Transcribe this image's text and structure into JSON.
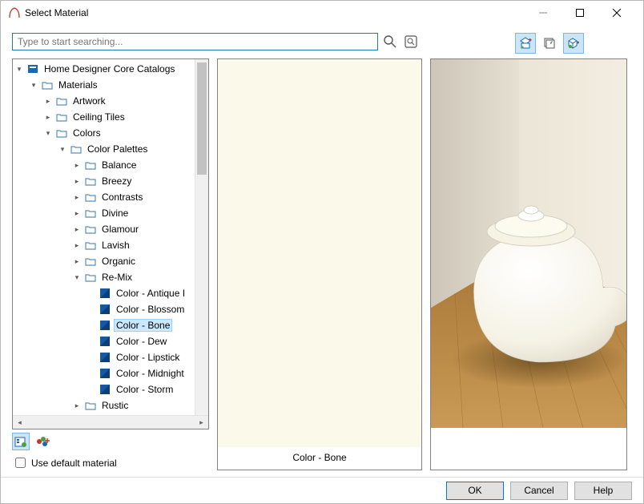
{
  "window": {
    "title": "Select Material"
  },
  "search": {
    "placeholder": "Type to start searching..."
  },
  "tree": {
    "root": "Home Designer Core Catalogs",
    "materials": "Materials",
    "artwork": "Artwork",
    "ceiling": "Ceiling Tiles",
    "colors": "Colors",
    "palettes": "Color Palettes",
    "balance": "Balance",
    "breezy": "Breezy",
    "contrasts": "Contrasts",
    "divine": "Divine",
    "glamour": "Glamour",
    "lavish": "Lavish",
    "organic": "Organic",
    "remix": "Re-Mix",
    "antique": "Color - Antique I",
    "blossom": "Color - Blossom",
    "bone": "Color - Bone",
    "dew": "Color - Dew",
    "lipstick": "Color - Lipstick",
    "midnight": "Color - Midnight",
    "storm": "Color - Storm",
    "rustic": "Rustic"
  },
  "center": {
    "label": "Color - Bone",
    "swatch": "#fbf9ea"
  },
  "checkbox": {
    "label": "Use default material"
  },
  "footer": {
    "ok": "OK",
    "cancel": "Cancel",
    "help": "Help"
  }
}
